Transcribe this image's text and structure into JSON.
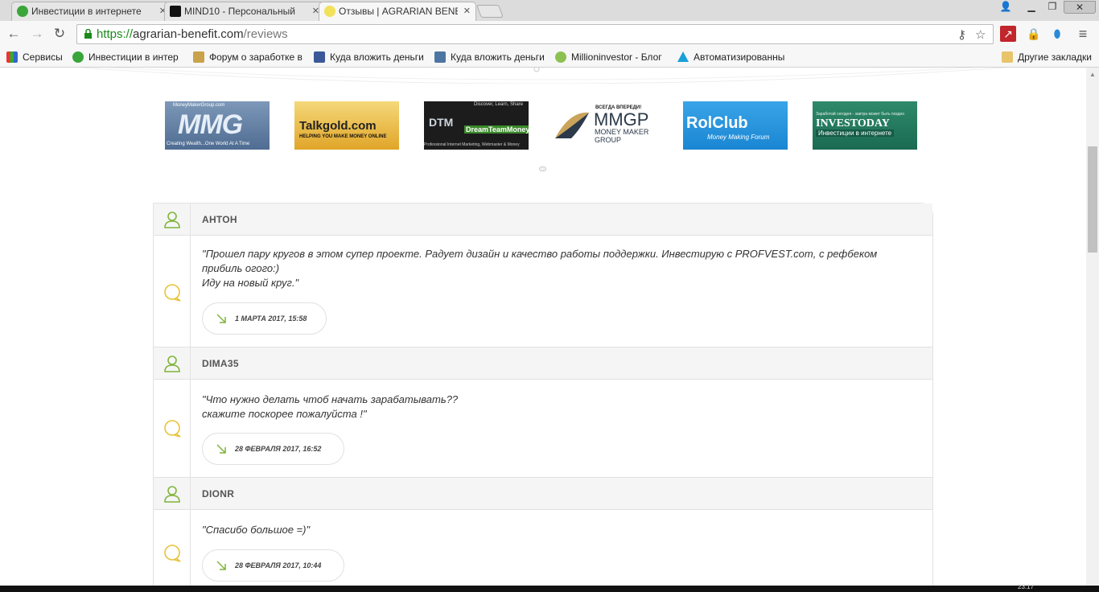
{
  "browser": {
    "tabs": [
      {
        "title": "Инвестиции в интернете",
        "active": false
      },
      {
        "title": "MIND10 - Персональный",
        "active": false
      },
      {
        "title": "Отзывы | AGRARIAN BENEFIT",
        "active": true
      }
    ],
    "url": {
      "scheme": "https://",
      "host": "agrarian-benefit.com",
      "path": "/reviews"
    },
    "bookmarks": [
      {
        "label": "Сервисы",
        "icon": "apps-grid-icon"
      },
      {
        "label": "Инвестиции в интер",
        "icon": "invest-favicon"
      },
      {
        "label": "Форум о заработке в",
        "icon": "forum-favicon"
      },
      {
        "label": "Куда вложить деньги",
        "icon": "facebook-icon"
      },
      {
        "label": "Куда вложить деньги",
        "icon": "vk-icon"
      },
      {
        "label": "Millioninvestor - Блог",
        "icon": "millioninvestor-favicon"
      },
      {
        "label": "Автоматизированны",
        "icon": "triangle-favicon"
      }
    ],
    "other_bookmarks": "Другие закладки"
  },
  "partners": [
    {
      "name": "MMG",
      "line1": "MoneyMakerGroup.com",
      "line2": "Creating Wealth...One World At A Time"
    },
    {
      "name": "Talkgold.com",
      "line1": "Talkgold.com",
      "line2": "HELPING YOU MAKE MONEY ONLINE"
    },
    {
      "name": "DreamTeamMoney",
      "line1": "Discover, Learn, Share",
      "line2": "Professional Internet Marketing, Webmaster & Money"
    },
    {
      "name": "MMGP",
      "line1": "ВСЕГДА ВПЕРЕДИ!",
      "line2": "MMGP",
      "line3": "MONEY MAKER",
      "line4": "GROUP"
    },
    {
      "name": "RolClub",
      "line1": "RolClub",
      "line2": "Money Making Forum"
    },
    {
      "name": "INVESTODAY",
      "line1": "Заработай сегодня - завтра может быть поздно",
      "line2": "INVESTODAY",
      "line3": "Инвестиции в интернете"
    }
  ],
  "reviews": [
    {
      "author": "АНТОН",
      "text": "\"Прошел пару кругов в этом супер проекте. Радует дизайн и качество работы поддержки. Инвестирую с PROFVEST.com, с рефбеком прибиль огого:)\nИду на новый круг.\"",
      "date": "1 МАРТА 2017, 15:58"
    },
    {
      "author": "DIMA35",
      "text": "\"Что нужно делать чтоб начать зарабатывать??\nскажите поскорее пожалуйста !\"",
      "date": "28 ФЕВРАЛЯ 2017, 16:52"
    },
    {
      "author": "DIONR",
      "text": "\"Спасибо большое =)\"",
      "date": "28 ФЕВРАЛЯ 2017, 10:44"
    }
  ],
  "taskbar": {
    "clock": "23:17"
  },
  "colors": {
    "accent_green": "#7fb43a",
    "accent_yellow": "#e8c23a",
    "border": "#e2e2e2"
  }
}
